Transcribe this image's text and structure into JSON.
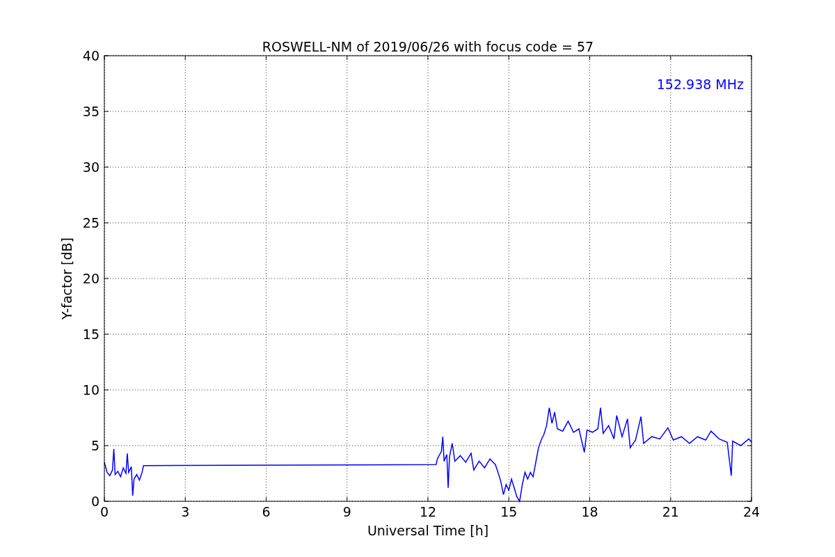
{
  "figure": {
    "chart_data": {
      "type": "line",
      "title": "ROSWELL-NM of 2019/06/26 with focus code = 57",
      "xlabel": "Universal Time [h]",
      "ylabel": "Y-factor [dB]",
      "x": [
        0,
        0.1,
        0.2,
        0.3,
        0.35,
        0.4,
        0.5,
        0.6,
        0.7,
        0.8,
        0.85,
        0.9,
        1.0,
        1.05,
        1.1,
        1.2,
        1.3,
        1.4,
        1.45,
        12.3,
        12.35,
        12.5,
        12.55,
        12.6,
        12.7,
        12.75,
        12.8,
        12.9,
        13.0,
        13.2,
        13.4,
        13.6,
        13.7,
        13.9,
        14.1,
        14.3,
        14.5,
        14.6,
        14.7,
        14.8,
        14.9,
        15.0,
        15.1,
        15.2,
        15.3,
        15.4,
        15.5,
        15.6,
        15.7,
        15.8,
        15.9,
        16.0,
        16.1,
        16.2,
        16.3,
        16.4,
        16.5,
        16.6,
        16.7,
        16.8,
        17.0,
        17.2,
        17.4,
        17.6,
        17.8,
        17.9,
        18.1,
        18.3,
        18.4,
        18.5,
        18.7,
        18.9,
        19.0,
        19.2,
        19.4,
        19.5,
        19.7,
        19.9,
        20.0,
        20.3,
        20.6,
        20.9,
        21.1,
        21.4,
        21.7,
        22.0,
        22.3,
        22.5,
        22.8,
        23.1,
        23.25,
        23.3,
        23.6,
        23.9,
        24.0
      ],
      "series": [
        {
          "name": "152.938 MHz",
          "color": "#0000ff",
          "values": [
            3.5,
            2.6,
            2.3,
            2.8,
            4.7,
            2.4,
            2.7,
            2.2,
            3.0,
            2.5,
            4.3,
            2.6,
            3.1,
            0.5,
            2.0,
            2.4,
            1.9,
            2.6,
            3.2,
            3.3,
            3.8,
            4.5,
            5.8,
            3.6,
            4.2,
            1.2,
            4.0,
            5.2,
            3.6,
            4.1,
            3.5,
            4.3,
            2.8,
            3.6,
            3.0,
            3.8,
            3.3,
            2.6,
            1.8,
            0.6,
            1.5,
            1.0,
            2.0,
            1.2,
            0.4,
            0.0,
            1.5,
            2.6,
            2.0,
            2.6,
            2.2,
            3.5,
            4.8,
            5.5,
            6.0,
            6.8,
            8.4,
            7.0,
            8.0,
            6.5,
            6.3,
            7.2,
            6.2,
            6.5,
            4.4,
            6.4,
            6.2,
            6.5,
            8.4,
            6.1,
            6.8,
            5.6,
            7.7,
            5.8,
            7.4,
            4.8,
            5.5,
            7.6,
            5.2,
            5.8,
            5.6,
            6.6,
            5.5,
            5.8,
            5.2,
            5.8,
            5.5,
            6.3,
            5.6,
            5.3,
            2.3,
            5.4,
            5.0,
            5.6,
            5.3
          ]
        }
      ],
      "grid": true,
      "xlim": [
        0,
        24
      ],
      "ylim": [
        0,
        40
      ],
      "xticks": [
        0,
        3,
        6,
        9,
        12,
        15,
        18,
        21,
        24
      ],
      "yticks": [
        0,
        5,
        10,
        15,
        20,
        25,
        30,
        35,
        40
      ]
    }
  }
}
